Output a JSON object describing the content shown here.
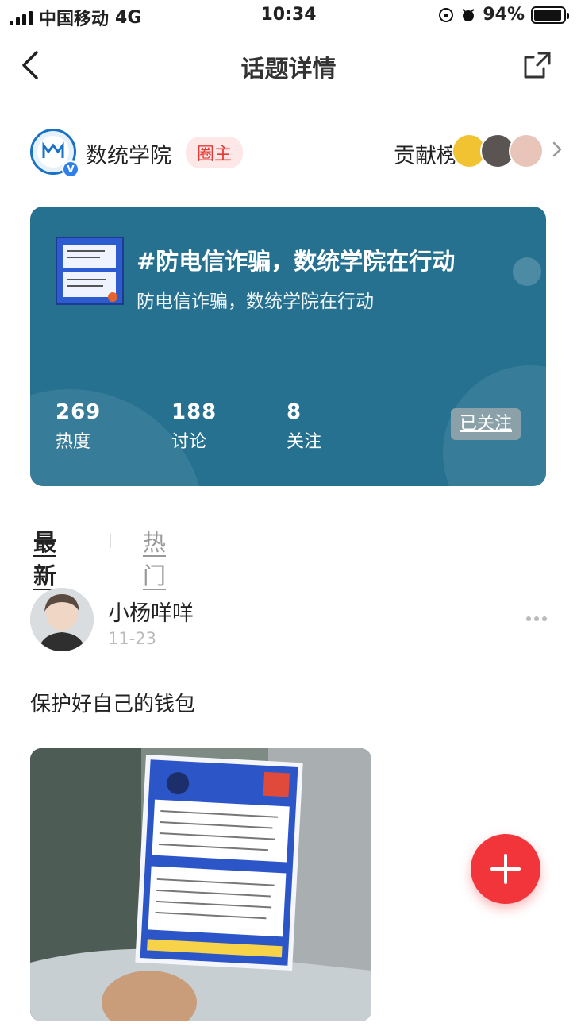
{
  "status_bar": {
    "carrier": "中国移动",
    "network": "4G",
    "time": "10:34",
    "battery": "94%",
    "battery_level": 0.94
  },
  "nav": {
    "title": "话题详情",
    "back_icon": "chevron-left-icon",
    "share_icon": "share-icon"
  },
  "circle": {
    "name": "数统学院",
    "owner_badge": "圈主",
    "contributors_label": "贡献榜"
  },
  "topic": {
    "title": "#防电信诈骗，数统学院在行动",
    "subtitle": "防电信诈骗，数统学院在行动",
    "stats": [
      {
        "value": "269",
        "label": "热度"
      },
      {
        "value": "188",
        "label": "讨论"
      },
      {
        "value": "8",
        "label": "关注"
      }
    ],
    "follow_label": "已关注"
  },
  "tabs": [
    {
      "label": "最新",
      "active": true
    },
    {
      "label": "热门",
      "active": false
    }
  ],
  "post": {
    "username": "小杨咩咩",
    "date": "11-23",
    "text": "保护好自己的钱包"
  },
  "colors": {
    "card_bg": "#277190",
    "accent_red": "#f2353a",
    "badge_bg": "#fde7e7"
  }
}
